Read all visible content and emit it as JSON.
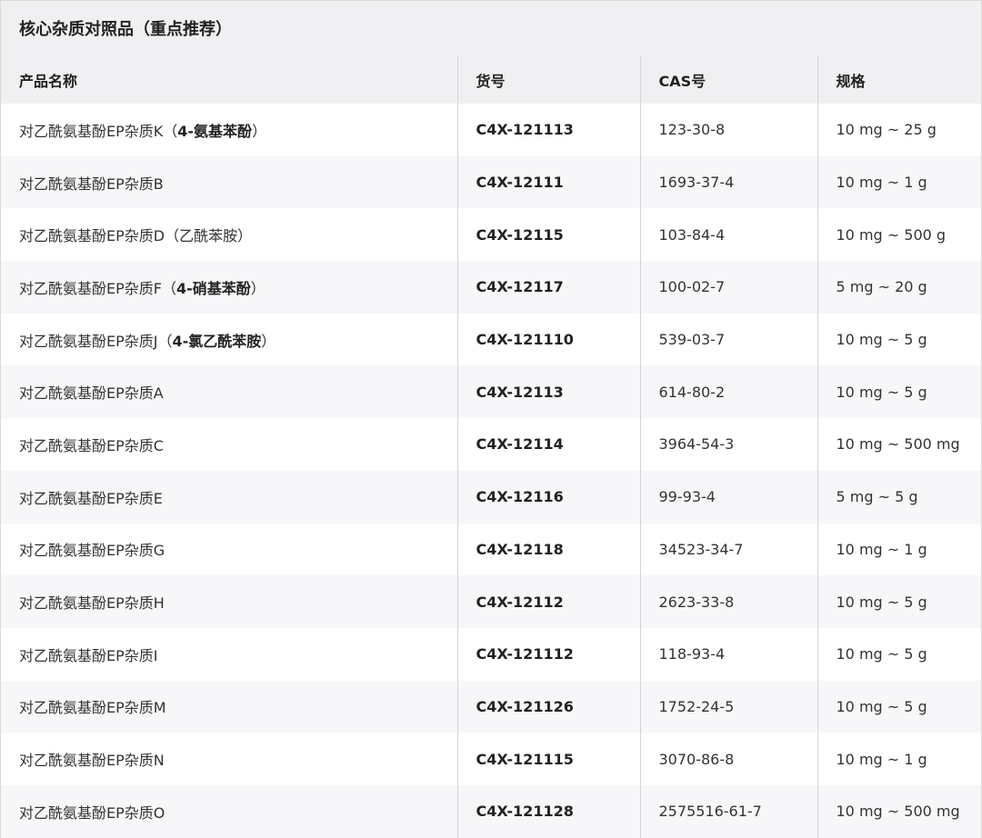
{
  "title": "核心杂质对照品（重点推荐）",
  "headers": [
    "产品名称",
    "货号",
    "CAS号",
    "规格"
  ],
  "rows": [
    {
      "name": "对乙酰氨基酚EP杂质K",
      "name_note": "4-氨基苯酚",
      "code": "C4X-121113",
      "cas": "123-30-8",
      "spec": "10 mg ~ 25 g"
    },
    {
      "name": "对乙酰氨基酚EP杂质B",
      "name_note": "",
      "code": "C4X-12111",
      "cas": "1693-37-4",
      "spec": "10 mg ~ 1 g"
    },
    {
      "name": "对乙酰氨基酚EP杂质D（乙酰苯胺）",
      "name_note": "",
      "code": "C4X-12115",
      "cas": "103-84-4",
      "spec": "10 mg ~ 500 g"
    },
    {
      "name": "对乙酰氨基酚EP杂质F",
      "name_note": "4-硝基苯酚",
      "code": "C4X-12117",
      "cas": "100-02-7",
      "spec": "5 mg ~ 20 g"
    },
    {
      "name": "对乙酰氨基酚EP杂质J",
      "name_note": "4-氯乙酰苯胺",
      "code": "C4X-121110",
      "cas": "539-03-7",
      "spec": "10 mg ~ 5 g"
    },
    {
      "name": "对乙酰氨基酚EP杂质A",
      "name_note": "",
      "code": "C4X-12113",
      "cas": "614-80-2",
      "spec": "10 mg ~ 5 g"
    },
    {
      "name": "对乙酰氨基酚EP杂质C",
      "name_note": "",
      "code": "C4X-12114",
      "cas": "3964-54-3",
      "spec": "10 mg ~ 500 mg"
    },
    {
      "name": "对乙酰氨基酚EP杂质E",
      "name_note": "",
      "code": "C4X-12116",
      "cas": "99-93-4",
      "spec": "5 mg ~ 5 g"
    },
    {
      "name": "对乙酰氨基酚EP杂质G",
      "name_note": "",
      "code": "C4X-12118",
      "cas": "34523-34-7",
      "spec": "10 mg ~ 1 g"
    },
    {
      "name": "对乙酰氨基酚EP杂质H",
      "name_note": "",
      "code": "C4X-12112",
      "cas": "2623-33-8",
      "spec": "10 mg ~ 5 g"
    },
    {
      "name": "对乙酰氨基酚EP杂质I",
      "name_note": "",
      "code": "C4X-121112",
      "cas": "118-93-4",
      "spec": "10 mg ~ 5 g"
    },
    {
      "name": "对乙酰氨基酚EP杂质M",
      "name_note": "",
      "code": "C4X-121126",
      "cas": "1752-24-5",
      "spec": "10 mg ~ 5 g"
    },
    {
      "name": "对乙酰氨基酚EP杂质N",
      "name_note": "",
      "code": "C4X-121115",
      "cas": "3070-86-8",
      "spec": "10 mg ~ 1 g"
    },
    {
      "name": "对乙酰氨基酚EP杂质O",
      "name_note": "",
      "code": "C4X-121128",
      "cas": "2575516-61-7",
      "spec": "10 mg ~ 500 mg"
    }
  ]
}
